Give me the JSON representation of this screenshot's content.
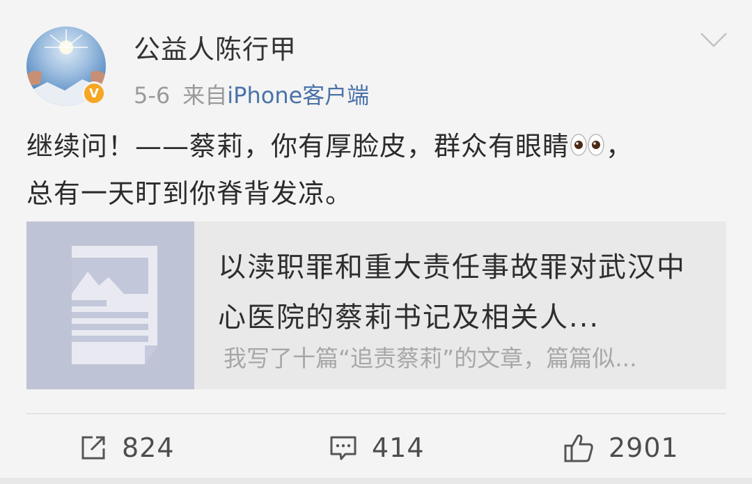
{
  "header": {
    "username": "公益人陈行甲",
    "date": "5-6",
    "from_label": "来自",
    "client": "iPhone客户端",
    "icons": [
      "avatar",
      "verified-badge-icon",
      "chevron-down-icon"
    ]
  },
  "post": {
    "line1_before": "继续问！——蔡莉，你有厚脸皮，群众有眼睛",
    "line1_after": "，",
    "line2": "总有一天盯到你脊背发凉。",
    "emoji": "eyes-icon"
  },
  "card": {
    "title": "以渎职罪和重大责任事故罪对武汉中心医院的蔡莉书记及相关人...",
    "description": "我写了十篇“追责蔡莉”的文章，篇篇似...",
    "thumbnail_icon": "article-icon"
  },
  "actions": {
    "repost_count": "824",
    "comment_count": "414",
    "like_count": "2901"
  },
  "colors": {
    "background": "#f4f4f4",
    "client_link": "#4a72a8",
    "verified_badge": "#f5a623",
    "thumbnail": "#bfc3d6"
  }
}
